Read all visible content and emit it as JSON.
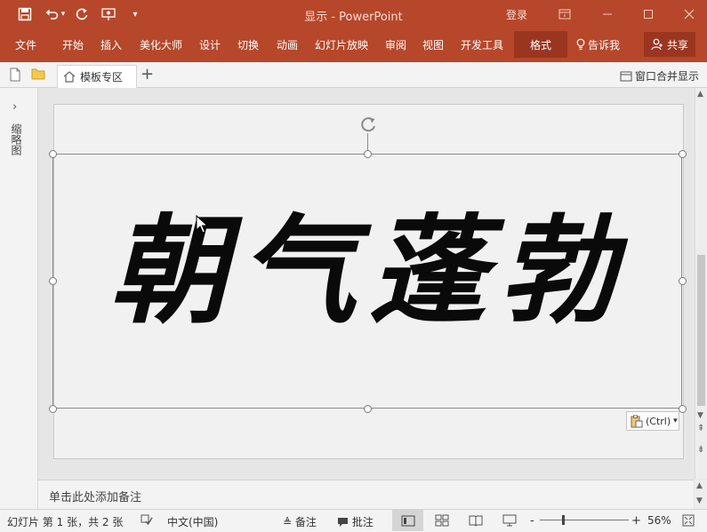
{
  "window": {
    "title": "显示  -  PowerPoint",
    "login": "登录"
  },
  "ribbon": {
    "tabs": [
      {
        "label": "文件"
      },
      {
        "label": "开始"
      },
      {
        "label": "插入"
      },
      {
        "label": "美化大师"
      },
      {
        "label": "设计"
      },
      {
        "label": "切换"
      },
      {
        "label": "动画"
      },
      {
        "label": "幻灯片放映"
      },
      {
        "label": "审阅"
      },
      {
        "label": "视图"
      },
      {
        "label": "开发工具"
      }
    ],
    "active_tab": "格式",
    "tell_me": "告诉我",
    "share": "共享"
  },
  "toolbar2": {
    "template_tab": "模板专区",
    "merge_label": "窗口合并显示"
  },
  "left_panel": {
    "label": "缩略图"
  },
  "slide": {
    "text": "朝气蓬勃"
  },
  "paste_options": {
    "label": "(Ctrl)"
  },
  "notes": {
    "placeholder": "单击此处添加备注"
  },
  "status": {
    "slide_info": "幻灯片 第 1 张，共 2 张",
    "language": "中文(中国)",
    "notes_btn": "备注",
    "comments_btn": "批注",
    "zoom": "56%",
    "zoom_minus": "-",
    "zoom_plus": "+"
  },
  "colors": {
    "accent": "#b7472a",
    "accent_dark": "#9a3620"
  }
}
